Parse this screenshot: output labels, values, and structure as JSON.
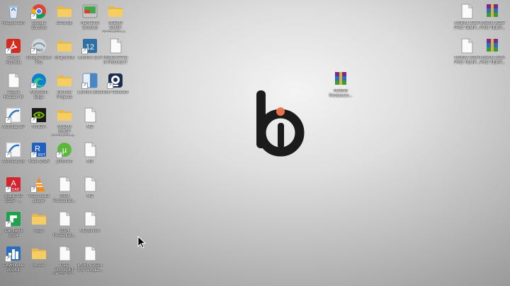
{
  "desktop": {
    "left_icons": [
      {
        "name": "recycle-bin-icon",
        "label": "Recycle Bin",
        "kind": "recycle",
        "col": 0,
        "row": 0
      },
      {
        "name": "google-chrome-icon",
        "label": "Google Chrome",
        "kind": "chrome",
        "col": 1,
        "row": 0
      },
      {
        "name": "desktop-folder-icon",
        "label": "Desktop",
        "kind": "folder",
        "col": 2,
        "row": 0
      },
      {
        "name": "hard-disk-sentinel-icon",
        "label": "Hard Disk Sentinel",
        "kind": "disk",
        "col": 3,
        "row": 0
      },
      {
        "name": "msbim-shop-shelves-folder-icon",
        "label": "MSBIM SHOP SHELVES A...",
        "kind": "folder",
        "col": 4,
        "row": 0
      },
      {
        "name": "adobe-acrobat-icon",
        "label": "Adobe Acrobat",
        "kind": "acrobat",
        "col": 0,
        "row": 1
      },
      {
        "name": "google-earth-pro-icon",
        "label": "Google Earth Pro",
        "kind": "earth",
        "col": 1,
        "row": 1
      },
      {
        "name": "graphisoft-folder-icon",
        "label": "Graphisoft",
        "kind": "folder",
        "col": 2,
        "row": 1
      },
      {
        "name": "lumion-12-5-icon",
        "label": "Lumion 12.5",
        "kind": "lumion12",
        "col": 3,
        "row": 1
      },
      {
        "name": "renovation-project-file-icon",
        "label": "RENOVATION PROJECT",
        "kind": "doc",
        "col": 4,
        "row": 1
      },
      {
        "name": "adobe-reader-xi-icon",
        "label": "Adobe Reader XI",
        "kind": "doc",
        "col": 0,
        "row": 2
      },
      {
        "name": "microsoft-edge-icon",
        "label": "Microsoft Edge",
        "kind": "edge",
        "col": 1,
        "row": 2
      },
      {
        "name": "mothuo-projects-folder-icon",
        "label": "Mothuo Projects",
        "kind": "folder",
        "col": 2,
        "row": 2
      },
      {
        "name": "lumion-2023-icon",
        "label": "Lumion 2023",
        "kind": "lumion23",
        "col": 3,
        "row": 2
      },
      {
        "name": "iriun-webcam-icon",
        "label": "Iriun Webcam",
        "kind": "webcam",
        "col": 4,
        "row": 2
      },
      {
        "name": "archicad-27-icon",
        "label": "Archicad 27",
        "kind": "archicad",
        "col": 0,
        "row": 3
      },
      {
        "name": "nvidia-icon",
        "label": "NVIDIA",
        "kind": "nvidia",
        "col": 1,
        "row": 3
      },
      {
        "name": "msbim-shop-shelves-folder-2-icon",
        "label": "MSBIM SHOP SHELVES A...",
        "kind": "folder",
        "col": 2,
        "row": 3
      },
      {
        "name": "md-file-icon",
        "label": "MD",
        "kind": "doc",
        "col": 3,
        "row": 3
      },
      {
        "name": "archicad-28-icon",
        "label": "Archicad 28",
        "kind": "archicad",
        "col": 0,
        "row": 4
      },
      {
        "name": "revit-2025-icon",
        "label": "Revit 2025",
        "kind": "revit",
        "col": 1,
        "row": 4
      },
      {
        "name": "utorrent-icon",
        "label": "µTorrent",
        "kind": "utorrent",
        "col": 2,
        "row": 4
      },
      {
        "name": "md-file-2-icon",
        "label": "MD",
        "kind": "doc",
        "col": 3,
        "row": 4
      },
      {
        "name": "autocad-2025-icon",
        "label": "AutoCAD 2025 - ...",
        "kind": "autocad",
        "col": 0,
        "row": 5
      },
      {
        "name": "vlc-media-player-icon",
        "label": "VLC media player",
        "kind": "vlc",
        "col": 1,
        "row": 5
      },
      {
        "name": "presentation-2024-file-icon",
        "label": "2024 Presentati...",
        "kind": "doc",
        "col": 2,
        "row": 5
      },
      {
        "name": "md-file-3-icon",
        "label": "MD",
        "kind": "doc",
        "col": 3,
        "row": 5
      },
      {
        "name": "camtasia-2024-icon",
        "label": "Camtasia 2024",
        "kind": "camtasia",
        "col": 0,
        "row": 6
      },
      {
        "name": "apps-folder-icon",
        "label": "Apps",
        "kind": "folder",
        "col": 1,
        "row": 6
      },
      {
        "name": "presentation-2024-file-2-icon",
        "label": "2024 Presentati...",
        "kind": "doc",
        "col": 2,
        "row": 6
      },
      {
        "name": "md-pinlick-file-icon",
        "label": "MD.pinlick",
        "kind": "doc",
        "col": 3,
        "row": 6
      },
      {
        "name": "cityengine-2024-icon",
        "label": "CityEngine 2024.1",
        "kind": "cityengine",
        "col": 0,
        "row": 7
      },
      {
        "name": "bruce-folder-icon",
        "label": "Bruce",
        "kind": "folder",
        "col": 1,
        "row": 7
      },
      {
        "name": "clc-office-block-file-icon",
        "label": "CLC 20_GCET Office Bloc...",
        "kind": "doc",
        "col": 2,
        "row": 7
      },
      {
        "name": "msbim-2024-pro-template-file-icon",
        "label": "MSBIM 2024 Pro Templa...",
        "kind": "doc",
        "col": 3,
        "row": 7
      }
    ],
    "middle_icon": {
      "name": "msbim-rar-archive-icon",
      "label": "MSBIM Restauran...",
      "kind": "rar"
    },
    "right_icons": [
      {
        "name": "msbim-2025-template-file-icon",
        "label": "MSBIM 2025 PRO TEMP...",
        "kind": "doc",
        "col": 0,
        "row": 0
      },
      {
        "name": "msbim-2025-template-rar-icon",
        "label": "MSBIM 2025 PRO TEMP...",
        "kind": "rar",
        "col": 1,
        "row": 0
      },
      {
        "name": "msbim-2025-template-file-2-icon",
        "label": "MSBIM 2025 PRO TEMP...",
        "kind": "doc",
        "col": 0,
        "row": 1
      },
      {
        "name": "msbim-2025-template-rar-2-icon",
        "label": "MSBIM 2025 PRO TEMP...",
        "kind": "rar",
        "col": 1,
        "row": 1
      }
    ],
    "wallpaper": {
      "logo": "bi-logo",
      "logo_color": "#1a1a1a",
      "dot_color": "#e8734a"
    }
  }
}
